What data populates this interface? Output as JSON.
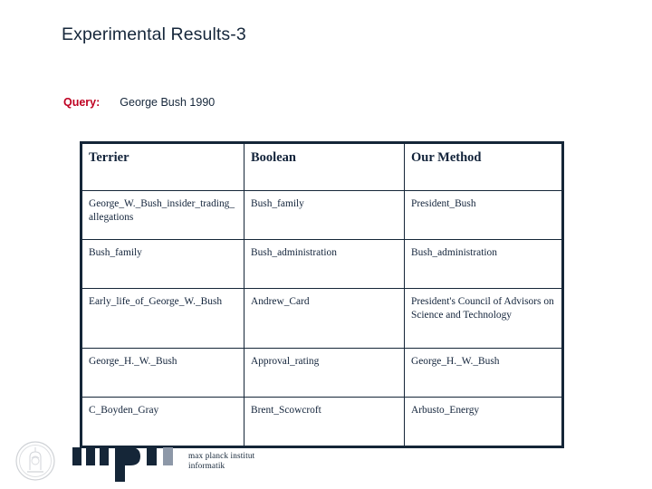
{
  "slide": {
    "title": "Experimental Results-3"
  },
  "query": {
    "label": "Query:",
    "value": "George Bush 1990",
    "label_color": "#bf0021",
    "value_color": "#16273b"
  },
  "table": {
    "border_color": "#152638",
    "columns": [
      "Terrier",
      "Boolean",
      "Our Method"
    ],
    "rows": [
      {
        "terrier": "George_W._Bush_insider_trading_allegations",
        "boolean": "Bush_family",
        "our_method": "President_Bush"
      },
      {
        "terrier": "Bush_family",
        "boolean": "Bush_administration",
        "our_method": "Bush_administration"
      },
      {
        "terrier": "Early_life_of_George_W._Bush",
        "boolean": "Andrew_Card",
        "our_method": "President's Council of Advisors on Science and Technology"
      },
      {
        "terrier": "George_H._W._Bush",
        "boolean": "Approval_rating",
        "our_method": "George_H._W._Bush"
      },
      {
        "terrier": "C_Boyden_Gray",
        "boolean": "Brent_Scowcroft",
        "our_method": "Arbusto_Energy"
      }
    ]
  },
  "footer": {
    "logo_line1": "max planck institut",
    "logo_line2": "informatik",
    "logo_color": "#152638",
    "logo_accent_color": "#8d98a8"
  }
}
